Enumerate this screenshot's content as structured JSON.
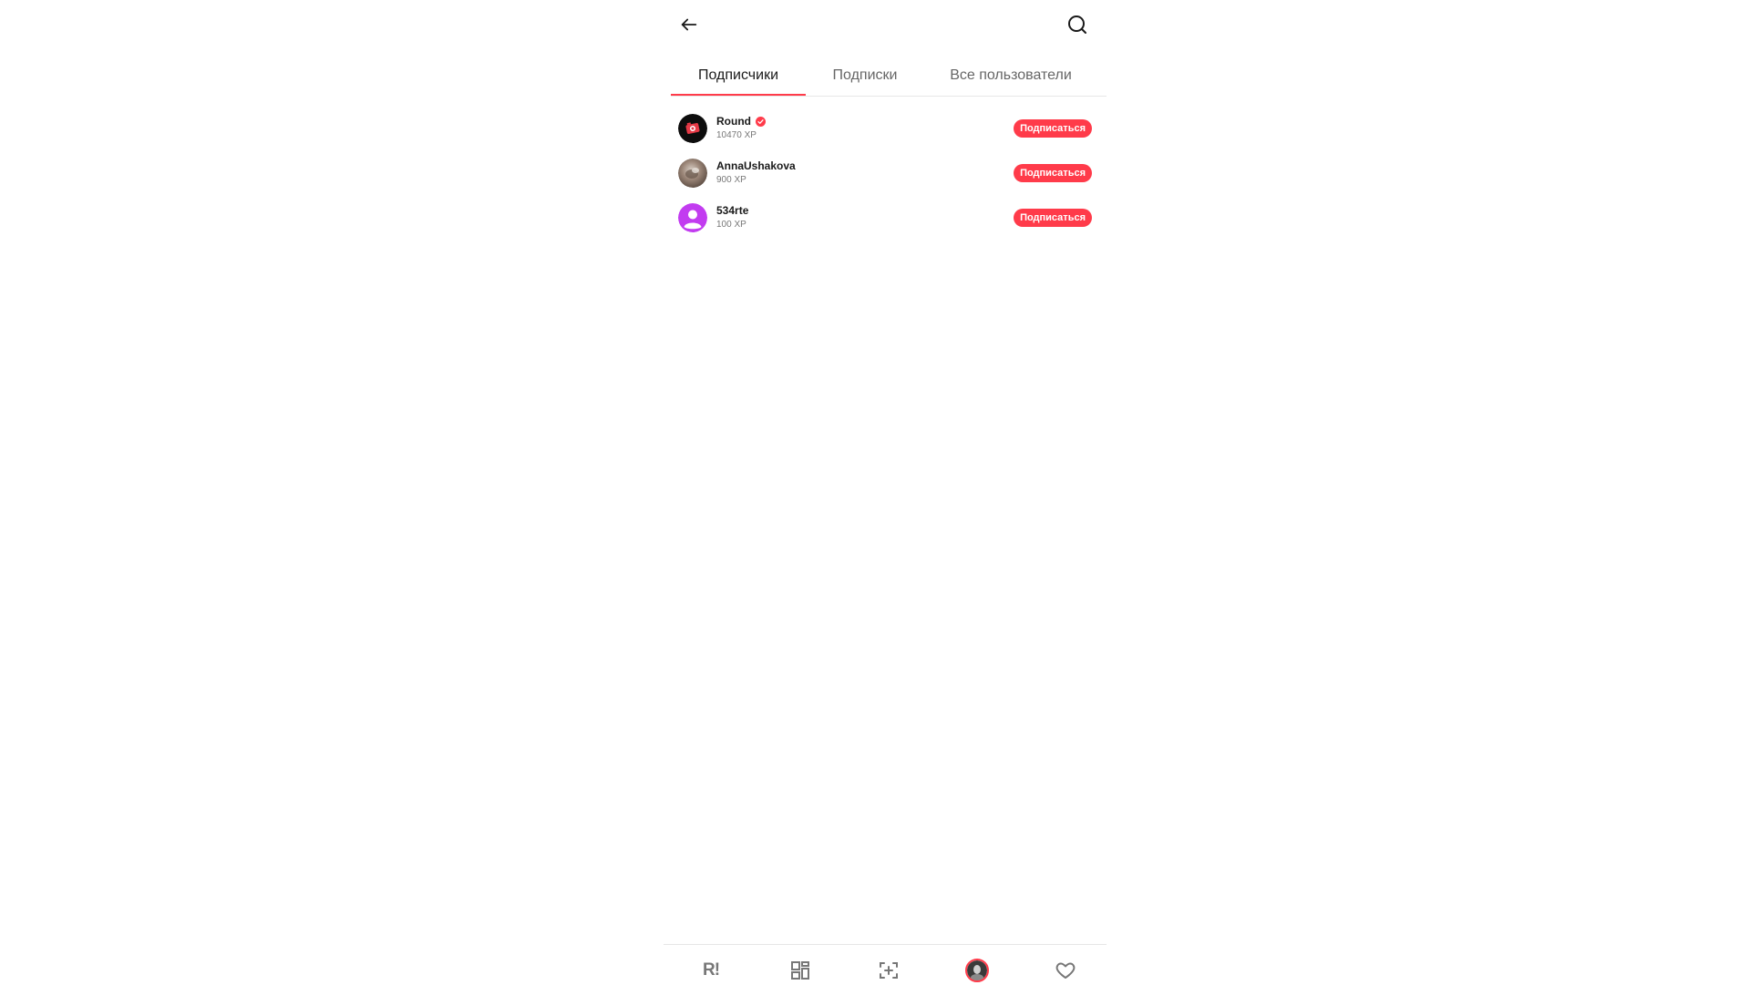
{
  "header": {
    "back_icon": "arrow-left-icon",
    "search_icon": "search-icon"
  },
  "tabs": [
    {
      "label": "Подписчики",
      "active": true
    },
    {
      "label": "Подписки",
      "active": false
    },
    {
      "label": "Все пользователи",
      "active": false
    }
  ],
  "users": [
    {
      "name": "Round",
      "xp": "10470 XP",
      "verified": true,
      "avatar": "round-logo-avatar",
      "button": "Подписаться"
    },
    {
      "name": "AnnaUshakova",
      "xp": "900 XP",
      "verified": false,
      "avatar": "photo-avatar",
      "button": "Подписаться"
    },
    {
      "name": "534rte",
      "xp": "100 XP",
      "verified": false,
      "avatar": "default-user-avatar",
      "button": "Подписаться"
    }
  ],
  "bottom_nav": {
    "logo_text": "R!",
    "items": [
      "home-logo-icon",
      "dashboard-icon",
      "add-scan-icon",
      "profile-avatar",
      "heart-icon"
    ]
  },
  "colors": {
    "accent": "#ff3b4a",
    "default_avatar": "#c23cf0",
    "text_primary": "#1a1a1a",
    "text_secondary": "#777777"
  }
}
